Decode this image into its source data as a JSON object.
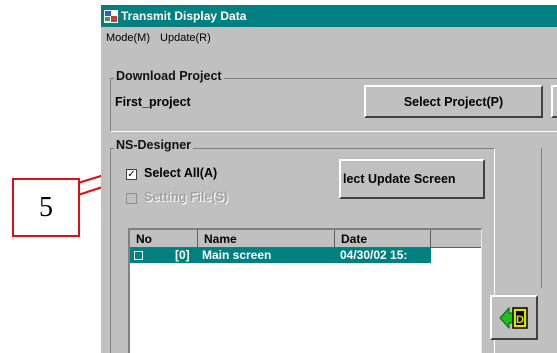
{
  "window": {
    "title": "Transmit Display Data",
    "title_bar_color": "#008080",
    "app_icon": "transmit-app-icon"
  },
  "menu": {
    "items": [
      {
        "label": "Mode(M)"
      },
      {
        "label": "Update(R)"
      }
    ]
  },
  "download_project": {
    "group_label": "Download Project",
    "project_name": "First_project",
    "select_button_label": "Select Project(P)"
  },
  "ns_designer": {
    "group_label": "NS-Designer",
    "select_all": {
      "label": "Select All(A)",
      "checked": true
    },
    "setting_file": {
      "label": "Setting File(S)",
      "checked": false,
      "enabled": false
    },
    "select_update_button_label": "lect Update Screen"
  },
  "screen_list": {
    "columns": [
      "No",
      "Name",
      "Date"
    ],
    "rows": [
      {
        "no": "[0]",
        "name": "Main screen",
        "date": "04/30/02 15:"
      }
    ],
    "selected_row_color": "#008080"
  },
  "transmit_button": {
    "icon": "transmit-arrow-icon"
  },
  "callout": {
    "number": "5",
    "color": "#dd1111"
  }
}
